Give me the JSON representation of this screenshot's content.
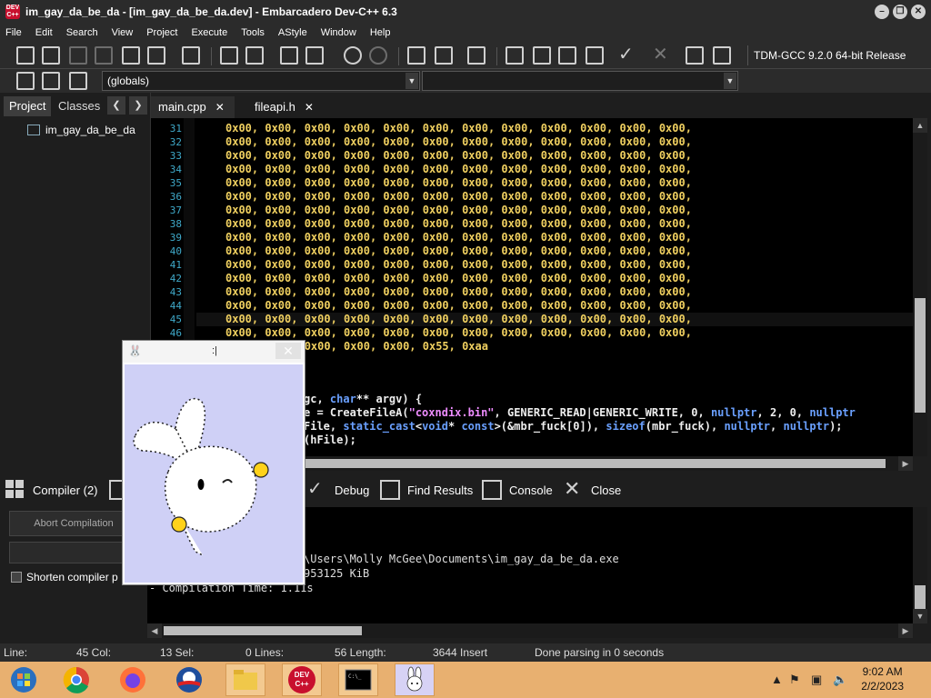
{
  "window": {
    "title": "im_gay_da_be_da - [im_gay_da_be_da.dev] - Embarcadero Dev-C++ 6.3",
    "app_icon_text": "DEV C++"
  },
  "menu": [
    "File",
    "Edit",
    "Search",
    "View",
    "Project",
    "Execute",
    "Tools",
    "AStyle",
    "Window",
    "Help"
  ],
  "toolbar": {
    "compiler": "TDM-GCC 9.2.0 64-bit Release",
    "scope_combo": "(globals)",
    "function_combo": ""
  },
  "left_panel": {
    "tabs": [
      "Project",
      "Classes"
    ],
    "tree_item": "im_gay_da_be_da"
  },
  "editor": {
    "tabs": [
      {
        "label": "main.cpp",
        "close": "✕"
      },
      {
        "label": "fileapi.h",
        "close": "✕"
      }
    ],
    "line_numbers": [
      "31",
      "32",
      "33",
      "34",
      "35",
      "36",
      "37",
      "38",
      "39",
      "40",
      "41",
      "42",
      "43",
      "44",
      "45",
      "46"
    ],
    "hex_row": "0x00, 0x00, 0x00, 0x00, 0x00, 0x00, 0x00, 0x00, 0x00, 0x00, 0x00, 0x00,",
    "last_hex_row": "0x00, 0x00, 0x00, 0x00, 0x00, 0x55, 0xaa",
    "code_lines": [
      {
        "parts": [
          {
            "t": "gc, ",
            "c": "plain"
          },
          {
            "t": "char",
            "c": "kw"
          },
          {
            "t": "** argv) {",
            "c": "plain"
          }
        ]
      },
      {
        "parts": [
          {
            "t": "e = CreateFileA(",
            "c": "plain"
          },
          {
            "t": "\"coxndix.bin\"",
            "c": "str"
          },
          {
            "t": ", GENERIC_READ|GENERIC_WRITE, 0, ",
            "c": "plain"
          },
          {
            "t": "nullptr",
            "c": "kw"
          },
          {
            "t": ", 2, 0, ",
            "c": "plain"
          },
          {
            "t": "nullptr",
            "c": "kw"
          }
        ]
      },
      {
        "parts": [
          {
            "t": "File, ",
            "c": "plain"
          },
          {
            "t": "static_cast",
            "c": "kw"
          },
          {
            "t": "<",
            "c": "plain"
          },
          {
            "t": "void",
            "c": "kw"
          },
          {
            "t": "* ",
            "c": "plain"
          },
          {
            "t": "const",
            "c": "kw"
          },
          {
            "t": ">(&mbr_fuck[0]), ",
            "c": "plain"
          },
          {
            "t": "sizeof",
            "c": "kw"
          },
          {
            "t": "(mbr_fuck), ",
            "c": "plain"
          },
          {
            "t": "nullptr",
            "c": "kw"
          },
          {
            "t": ", ",
            "c": "plain"
          },
          {
            "t": "nullptr",
            "c": "kw"
          },
          {
            "t": ");",
            "c": "plain"
          }
        ]
      },
      {
        "parts": [
          {
            "t": "(hFile);",
            "c": "plain"
          }
        ]
      }
    ]
  },
  "bottom_tabs": [
    "Compiler (2)",
    "Debug",
    "Find Results",
    "Console",
    "Close"
  ],
  "compile_panel": {
    "abort_label": "Abort Compilation",
    "shorten_label": "Shorten compiler p",
    "log_lines": [
      "\\Users\\Molly McGee\\Documents\\im_gay_da_be_da.exe",
      "953125 KiB",
      "- Compilation Time: 1.11s"
    ]
  },
  "status": {
    "line": "Line:",
    "col": "45 Col:",
    "sel": "13 Sel:",
    "lines": "0 Lines:",
    "length": "56 Length:",
    "insert": "3644 Insert",
    "message": "Done parsing in 0 seconds"
  },
  "float_window": {
    "caption": ":|",
    "close": "✕"
  },
  "taskbar": {
    "dev_label": "DEV C++",
    "time": "9:02 AM",
    "date": "2/2/2023"
  },
  "colors": {
    "hex_literal": "#f0d060",
    "keyword": "#6aa0ff",
    "string": "#ee8cff",
    "line_number": "#3fa9c9",
    "taskbar": "#e8b070"
  }
}
